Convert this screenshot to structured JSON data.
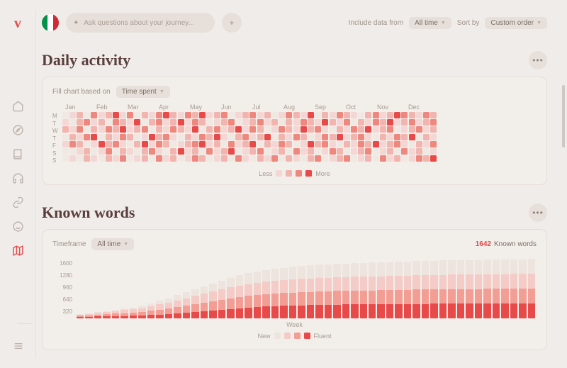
{
  "search": {
    "placeholder": "Ask questions about your journey...",
    "icon": "sparkle-icon"
  },
  "filters": {
    "include_label": "Include data from",
    "include_value": "All time",
    "sort_label": "Sort by",
    "sort_value": "Custom order"
  },
  "sections": {
    "daily": {
      "title": "Daily activity",
      "fill_label": "Fill chart based on",
      "fill_value": "Time spent"
    },
    "known": {
      "title": "Known words",
      "timeframe_label": "Timeframe",
      "timeframe_value": "All time",
      "count": "1642",
      "count_label": "Known words",
      "xaxis": "Week"
    }
  },
  "legend": {
    "less": "Less",
    "more": "More",
    "new": "New",
    "fluent": "Fluent"
  },
  "chart_data": [
    {
      "type": "heatmap",
      "title": "Daily activity",
      "rows": [
        "M",
        "T",
        "W",
        "T",
        "F",
        "S",
        "S"
      ],
      "months": [
        "Jan",
        "Feb",
        "Mar",
        "Apr",
        "May",
        "Jun",
        "Jul",
        "Aug",
        "Sep",
        "Oct",
        "Nov",
        "Dec"
      ],
      "scale": {
        "min": 0,
        "max": 4,
        "labels": [
          "Less",
          "",
          "",
          "",
          "More"
        ]
      },
      "values": [
        [
          0,
          1,
          2,
          0,
          3,
          1,
          2,
          4,
          1,
          3,
          0,
          2,
          1,
          3,
          4,
          2,
          1,
          3,
          2,
          4,
          1,
          2,
          3,
          0,
          1,
          2,
          3,
          1,
          2,
          0,
          1,
          3,
          2,
          1,
          4,
          0,
          2,
          1,
          3,
          2,
          1,
          0,
          2,
          3,
          1,
          2,
          4,
          3,
          2,
          1,
          3,
          2
        ],
        [
          1,
          0,
          2,
          3,
          1,
          2,
          0,
          3,
          2,
          1,
          4,
          0,
          2,
          3,
          1,
          2,
          4,
          1,
          3,
          2,
          0,
          1,
          2,
          3,
          0,
          1,
          2,
          3,
          1,
          2,
          0,
          2,
          1,
          3,
          2,
          1,
          4,
          2,
          1,
          3,
          0,
          2,
          1,
          3,
          2,
          4,
          1,
          2,
          3,
          1,
          2,
          3
        ],
        [
          2,
          1,
          3,
          0,
          2,
          1,
          3,
          2,
          4,
          1,
          2,
          3,
          0,
          2,
          1,
          3,
          2,
          1,
          4,
          0,
          2,
          3,
          1,
          2,
          4,
          1,
          3,
          2,
          0,
          1,
          3,
          2,
          1,
          4,
          2,
          3,
          1,
          0,
          2,
          1,
          3,
          2,
          4,
          1,
          2,
          3,
          0,
          1,
          2,
          3,
          1,
          2
        ],
        [
          0,
          2,
          1,
          3,
          4,
          0,
          2,
          1,
          3,
          2,
          0,
          1,
          4,
          2,
          3,
          1,
          0,
          2,
          1,
          3,
          2,
          4,
          1,
          0,
          2,
          3,
          1,
          2,
          4,
          0,
          2,
          1,
          3,
          2,
          0,
          1,
          3,
          2,
          4,
          1,
          2,
          3,
          1,
          0,
          2,
          1,
          3,
          2,
          4,
          0,
          2,
          1
        ],
        [
          1,
          3,
          2,
          0,
          1,
          4,
          2,
          3,
          1,
          0,
          2,
          4,
          1,
          3,
          2,
          0,
          1,
          2,
          3,
          4,
          1,
          2,
          0,
          3,
          1,
          2,
          4,
          0,
          2,
          1,
          3,
          2,
          0,
          1,
          4,
          2,
          3,
          1,
          0,
          2,
          1,
          3,
          2,
          4,
          1,
          2,
          3,
          1,
          0,
          2,
          1,
          3
        ],
        [
          0,
          0,
          1,
          2,
          0,
          1,
          3,
          0,
          2,
          1,
          0,
          2,
          3,
          1,
          0,
          2,
          4,
          1,
          2,
          0,
          3,
          1,
          2,
          4,
          0,
          1,
          2,
          3,
          0,
          1,
          2,
          0,
          3,
          1,
          2,
          0,
          1,
          3,
          2,
          0,
          1,
          2,
          3,
          0,
          1,
          2,
          0,
          3,
          1,
          2,
          0,
          1
        ],
        [
          0,
          1,
          0,
          2,
          1,
          0,
          2,
          1,
          3,
          0,
          1,
          2,
          0,
          3,
          1,
          2,
          0,
          1,
          3,
          2,
          0,
          1,
          2,
          0,
          3,
          1,
          0,
          2,
          1,
          3,
          0,
          2,
          1,
          0,
          2,
          3,
          0,
          1,
          2,
          3,
          0,
          1,
          2,
          0,
          3,
          1,
          2,
          0,
          1,
          3,
          2,
          4
        ]
      ]
    },
    {
      "type": "bar",
      "title": "Known words",
      "xlabel": "Week",
      "ylabel": "",
      "ylim": [
        0,
        1700
      ],
      "y_ticks": [
        1600,
        1280,
        960,
        640,
        320
      ],
      "categories_count": 52,
      "series": [
        {
          "name": "New",
          "color": "#eee4de"
        },
        {
          "name": "",
          "color": "#f4cbc6"
        },
        {
          "name": "",
          "color": "#f39e95"
        },
        {
          "name": "Fluent",
          "color": "#e84a4a"
        }
      ],
      "segments": [
        [
          10,
          30,
          30,
          30
        ],
        [
          15,
          40,
          40,
          35
        ],
        [
          20,
          50,
          50,
          40
        ],
        [
          25,
          60,
          60,
          45
        ],
        [
          30,
          70,
          70,
          50
        ],
        [
          40,
          80,
          80,
          55
        ],
        [
          50,
          90,
          90,
          60
        ],
        [
          60,
          100,
          100,
          70
        ],
        [
          80,
          120,
          120,
          80
        ],
        [
          100,
          140,
          140,
          90
        ],
        [
          120,
          160,
          160,
          100
        ],
        [
          140,
          180,
          180,
          120
        ],
        [
          160,
          200,
          200,
          140
        ],
        [
          180,
          220,
          220,
          160
        ],
        [
          200,
          240,
          240,
          180
        ],
        [
          220,
          260,
          260,
          200
        ],
        [
          240,
          280,
          280,
          220
        ],
        [
          260,
          300,
          300,
          240
        ],
        [
          280,
          310,
          310,
          260
        ],
        [
          300,
          320,
          320,
          280
        ],
        [
          310,
          330,
          330,
          300
        ],
        [
          320,
          340,
          340,
          310
        ],
        [
          330,
          345,
          345,
          320
        ],
        [
          340,
          350,
          350,
          330
        ],
        [
          345,
          355,
          355,
          340
        ],
        [
          350,
          360,
          360,
          345
        ],
        [
          355,
          365,
          365,
          350
        ],
        [
          360,
          368,
          368,
          355
        ],
        [
          365,
          370,
          370,
          360
        ],
        [
          368,
          372,
          372,
          365
        ],
        [
          370,
          374,
          374,
          368
        ],
        [
          372,
          376,
          376,
          370
        ],
        [
          374,
          378,
          378,
          372
        ],
        [
          376,
          380,
          380,
          374
        ],
        [
          378,
          382,
          382,
          376
        ],
        [
          380,
          384,
          384,
          378
        ],
        [
          382,
          386,
          386,
          380
        ],
        [
          384,
          388,
          388,
          382
        ],
        [
          386,
          390,
          390,
          384
        ],
        [
          388,
          391,
          391,
          386
        ],
        [
          390,
          392,
          392,
          388
        ],
        [
          391,
          393,
          393,
          390
        ],
        [
          392,
          394,
          394,
          391
        ],
        [
          393,
          395,
          395,
          392
        ],
        [
          394,
          396,
          396,
          393
        ],
        [
          395,
          397,
          397,
          394
        ],
        [
          396,
          398,
          398,
          395
        ],
        [
          397,
          399,
          399,
          396
        ],
        [
          398,
          400,
          400,
          397
        ],
        [
          399,
          401,
          401,
          398
        ],
        [
          400,
          402,
          402,
          399
        ],
        [
          401,
          403,
          403,
          400
        ]
      ]
    }
  ],
  "nav": [
    "home",
    "compass",
    "book",
    "headphones",
    "link",
    "smile",
    "map"
  ]
}
